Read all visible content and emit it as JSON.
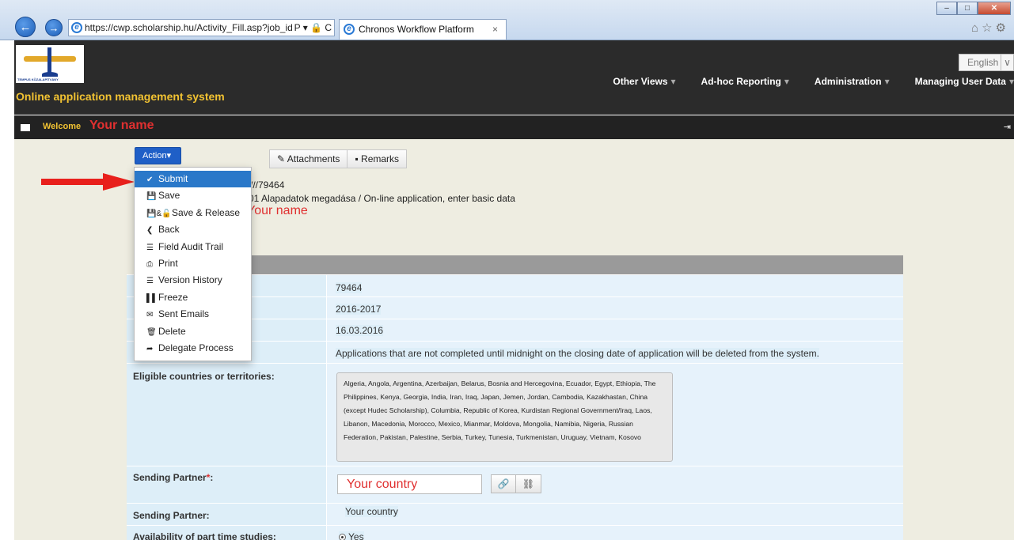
{
  "browser": {
    "url": "https://cwp.scholarship.hu/Activity_Fill.asp?job_id=",
    "url_suffix": "Ρ ▾ 🔒 C",
    "tab_title": "Chronos Workflow Platform",
    "tab_close": "×",
    "back_glyph": "←",
    "forward_glyph": "→",
    "window_buttons": [
      "–",
      "□",
      "✕"
    ],
    "toolbar_icons": "⌂☆⚙"
  },
  "header": {
    "logo_text": "TEMPUS KÖZALAPÍTVÁNY",
    "app_title": "Online application management system",
    "language": "English",
    "language_chevron": "∨",
    "menu": [
      {
        "label": "Other Views"
      },
      {
        "label": "Ad-hoc Reporting"
      },
      {
        "label": "Administration"
      },
      {
        "label": "Managing User Data"
      }
    ],
    "menu_caret": "▾"
  },
  "welcome": {
    "label": "Welcome",
    "name": "Your name",
    "logout_glyph": "⇥"
  },
  "toolbar": {
    "action_label": "Action▾",
    "attachments_label": "✎ Attachments",
    "remarks_label": "▪ Remarks"
  },
  "dropdown": {
    "items": [
      {
        "icon": "✔",
        "label": "Submit"
      },
      {
        "icon": "💾",
        "label": "Save"
      },
      {
        "icon": "💾&🔓",
        "label": "Save & Release"
      },
      {
        "icon": "❮",
        "label": "Back"
      },
      {
        "icon": "☰",
        "label": "Field Audit Trail"
      },
      {
        "icon": "⎙",
        "label": "Print"
      },
      {
        "icon": "☰",
        "label": "Version History"
      },
      {
        "icon": "▌▌",
        "label": "Freeze"
      },
      {
        "icon": "✉",
        "label": "Sent Emails"
      },
      {
        "icon": "🗑",
        "label": "Delete"
      },
      {
        "icon": "➦",
        "label": "Delegate Process"
      }
    ]
  },
  "info": {
    "job_ref": "///79464",
    "step": "01 Alapadatok megadása / On-line application, enter basic data",
    "owner_name": "Your name"
  },
  "form": {
    "rows": [
      {
        "label": "",
        "value": "79464"
      },
      {
        "label": "",
        "value": "2016-2017"
      },
      {
        "label": "",
        "value": "16.03.2016"
      },
      {
        "label": "",
        "value": "Applications that are not completed until midnight on the closing date of application will be deleted from the system."
      }
    ],
    "countries_label": "Eligible countries or territories:",
    "countries": "Algeria, Angola, Argentina, Azerbaijan, Belarus, Bosnia and Hercegovina, Ecuador, Egypt, Ethiopia, The Philippines, Kenya, Georgia, India, Iran, Iraq, Japan, Jemen, Jordan, Cambodia, Kazakhastan, China (except Hudec Scholarship), Columbia, Republic of Korea, Kurdistan Regional Government/Iraq, Laos, Libanon, Macedonia, Morocco, Mexico, Mianmar, Moldova, Mongolia, Namibia, Nigeria, Russian Federation, Pakistan, Palestine, Serbia, Turkey, Tunesia, Turkmenistan, Uruguay, Vietnam, Kosovo",
    "sending_partner_input_label": "Sending Partner",
    "required_mark": "*",
    "label_colon": ":",
    "sending_partner_value": "Your country",
    "link_icon": "🔗",
    "unlink_icon": "⛓",
    "sending_partner_label": "Sending Partner:",
    "sending_partner_readonly": "Your country",
    "part_time_label": "Availability of part time studies:",
    "part_time_value": "Yes"
  }
}
